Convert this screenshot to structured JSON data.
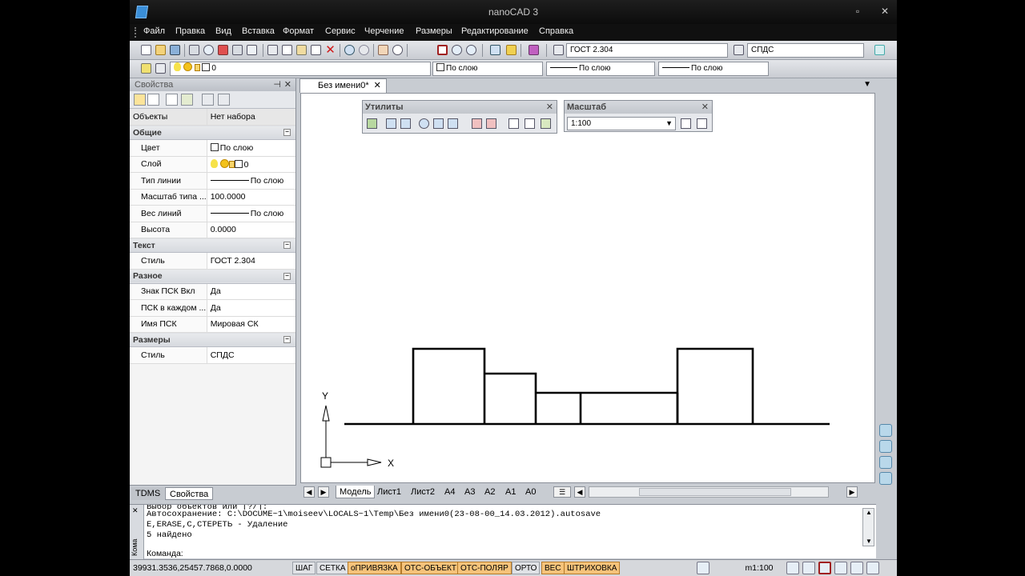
{
  "window": {
    "title": "nanoCAD 3",
    "controls": [
      "▫",
      "✕"
    ]
  },
  "menu": [
    "Файл",
    "Правка",
    "Вид",
    "Вставка",
    "Формат",
    "Сервис",
    "Черчение",
    "Размеры",
    "Редактирование",
    "Справка"
  ],
  "toolbar": {
    "text_style": "ГОСТ 2.304",
    "dim_style": "СПДС",
    "layer": "0",
    "color": "По слою",
    "linetype": "По слою",
    "lineweight": "По слою"
  },
  "props": {
    "title": "Свойства",
    "objects_label": "Объекты",
    "objects_value": "Нет набора",
    "general": {
      "title": "Общие",
      "rows": [
        {
          "k": "Цвет",
          "v": "По слою"
        },
        {
          "k": "Слой",
          "v": "0"
        },
        {
          "k": "Тип линии",
          "v": "По слою"
        },
        {
          "k": "Масштаб типа ...",
          "v": "100.0000"
        },
        {
          "k": "Вес линий",
          "v": "По слою"
        },
        {
          "k": "Высота",
          "v": "0.0000"
        }
      ]
    },
    "text": {
      "title": "Текст",
      "rows": [
        {
          "k": "Стиль",
          "v": "ГОСТ 2.304"
        }
      ]
    },
    "misc": {
      "title": "Разное",
      "rows": [
        {
          "k": "Знак ПСК Вкл",
          "v": "Да"
        },
        {
          "k": "ПСК в каждом ...",
          "v": "Да"
        },
        {
          "k": "Имя ПСК",
          "v": "Мировая СК"
        }
      ]
    },
    "dims": {
      "title": "Размеры",
      "rows": [
        {
          "k": "Стиль",
          "v": "СПДС"
        }
      ]
    },
    "tabs": [
      "TDMS",
      "Свойства"
    ]
  },
  "document": {
    "tab": "Без имени0*"
  },
  "floating": {
    "utils_title": "Утилиты",
    "scale_title": "Масштаб",
    "scale_value": "1:100"
  },
  "ucs": {
    "x": "X",
    "y": "Y"
  },
  "layouts": [
    "Модель",
    "Лист1",
    "Лист2",
    "A4",
    "A3",
    "A2",
    "A1",
    "A0"
  ],
  "command": {
    "lines": [
      "Выбор объектов или [?/]:",
      "Автосохранение: C:\\DOCUME~1\\moiseev\\LOCALS~1\\Temp\\Без имени0(23-08-00_14.03.2012).autosave",
      "E,ERASE,C,СТЕРЕТЬ - Удаление",
      "5 найдено"
    ],
    "prompt": "Команда:",
    "side_label": "Кома"
  },
  "status": {
    "coords": "39931.3536,25457.7868,0.0000",
    "buttons": [
      {
        "label": "ШАГ",
        "on": false
      },
      {
        "label": "СЕТКА",
        "on": false
      },
      {
        "label": "оПРИВЯЗКА",
        "on": true
      },
      {
        "label": "ОТС-ОБЪЕКТ",
        "on": true
      },
      {
        "label": "ОТС-ПОЛЯР",
        "on": true
      },
      {
        "label": "ОРТО",
        "on": false
      },
      {
        "label": "ВЕС",
        "on": true
      },
      {
        "label": "ШТРИХОВКА",
        "on": true
      }
    ],
    "scale": "m1:100"
  }
}
